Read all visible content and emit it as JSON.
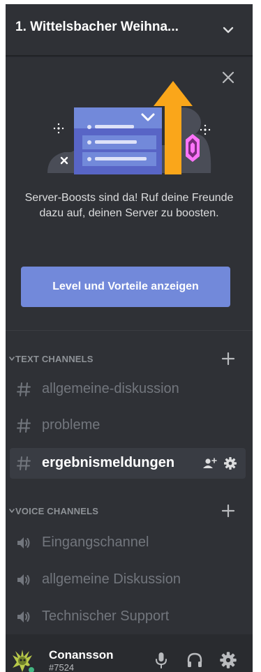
{
  "header": {
    "server_name": "1. Wittelsbacher Weihna..."
  },
  "boost_banner": {
    "text": "Server-Boosts sind da! Ruf deine Freunde dazu auf, deinen Server zu boosten.",
    "button_label": "Level und Vorteile anzeigen"
  },
  "text_channels": {
    "label": "TEXT CHANNELS",
    "items": [
      {
        "name": "allgemeine-diskussion"
      },
      {
        "name": "probleme"
      },
      {
        "name": "ergebnismeldungen"
      }
    ]
  },
  "voice_channels": {
    "label": "VOICE CHANNELS",
    "items": [
      {
        "name": "Eingangschannel"
      },
      {
        "name": "allgemeine Diskussion"
      },
      {
        "name": "Technischer Support"
      }
    ]
  },
  "user": {
    "username": "Conansson",
    "discriminator": "#7524"
  },
  "colors": {
    "sidebar_bg": "#2f3136",
    "userbar_bg": "#292b2f",
    "blurple": "#7289da",
    "muted_text": "#72767d",
    "online": "#43b581"
  },
  "icons": {
    "header": "chevron-down-icon",
    "banner_close": "close-icon",
    "category": "chevron-down-icon",
    "category_add": "plus-icon",
    "text_channel": "hash-icon",
    "voice_channel": "speaker-icon",
    "invite": "add-member-icon",
    "settings": "gear-icon",
    "mic": "microphone-icon",
    "headset": "headphones-icon"
  }
}
